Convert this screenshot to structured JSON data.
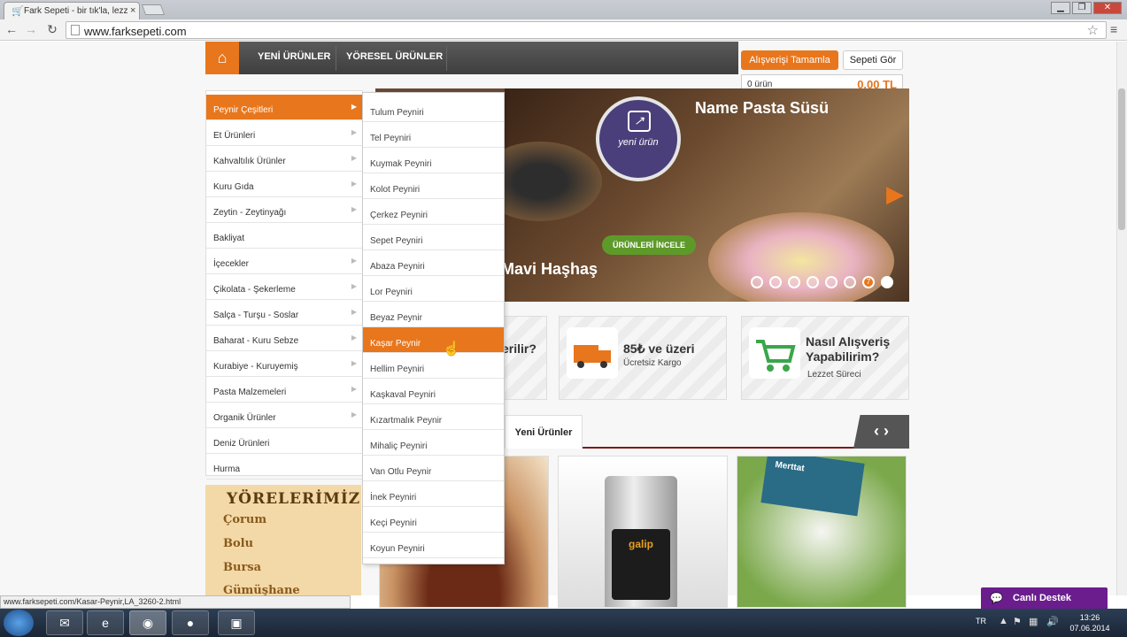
{
  "browser": {
    "tab_title": "Fark Sepeti - bir tık'la, lezz",
    "url": "www.farksepeti.com",
    "status_url": "www.farksepeti.com/Kasar-Peynir,LA_3260-2.html"
  },
  "nav": {
    "items": [
      "YENİ ÜRÜNLER",
      "YÖRESEL ÜRÜNLER"
    ]
  },
  "cart": {
    "complete_label": "Alışverişi Tamamla",
    "view_label": "Sepeti Gör",
    "count": "0 ürün",
    "total": "0.00 TL"
  },
  "categories": [
    "Peynir Çeşitleri",
    "Et Ürünleri",
    "Kahvaltılık Ürünler",
    "Kuru Gıda",
    "Zeytin - Zeytinyağı",
    "Bakliyat",
    "İçecekler",
    "Çikolata - Şekerleme",
    "Salça - Turşu - Soslar",
    "Baharat - Kuru Sebze",
    "Kurabiye - Kuruyemiş",
    "Pasta Malzemeleri",
    "Organik Ürünler",
    "Deniz Ürünleri",
    "Hurma"
  ],
  "subcategories": [
    "Tulum Peyniri",
    "Tel Peyniri",
    "Kuymak Peyniri",
    "Kolot Peyniri",
    "Çerkez Peyniri",
    "Sepet Peyniri",
    "Abaza Peyniri",
    "Lor Peyniri",
    "Beyaz Peynir",
    "Kaşar Peynir",
    "Hellim Peyniri",
    "Kaşkaval Peyniri",
    "Kızartmalık Peynir",
    "Mihaliç Peyniri",
    "Van Otlu Peynir",
    "İnek Peyniri",
    "Keçi Peyniri",
    "Koyun Peyniri"
  ],
  "slider": {
    "title1": "Name Pasta Süsü",
    "title2": "Mavi Haşhaş",
    "badge": "yeni ürün",
    "cta": "ÜRÜNLERİ İNCELE",
    "active_dot": "7"
  },
  "info": {
    "box1": "erilir?",
    "box2_title": "85₺ ve üzeri",
    "box2_sub": "Ücretsiz Kargo",
    "box3_title": "Nasıl Alışveriş Yapabilirim?",
    "box3_sub": "Lezzet Süreci"
  },
  "tabs": {
    "new_products": "Yeni Ürünler"
  },
  "products": {
    "p2_brand": "galip",
    "p3_brand": "Merttat"
  },
  "regions": {
    "title": "YÖRELERİMİZ",
    "items": [
      "Çorum",
      "Bolu",
      "Bursa",
      "Gümüşhane"
    ]
  },
  "chat": {
    "label": "Canlı Destek"
  },
  "taskbar": {
    "lang": "TR",
    "time": "13:26",
    "date": "07.06.2014"
  },
  "colors": {
    "accent": "#e8761c",
    "chat": "#6b1d8e"
  }
}
